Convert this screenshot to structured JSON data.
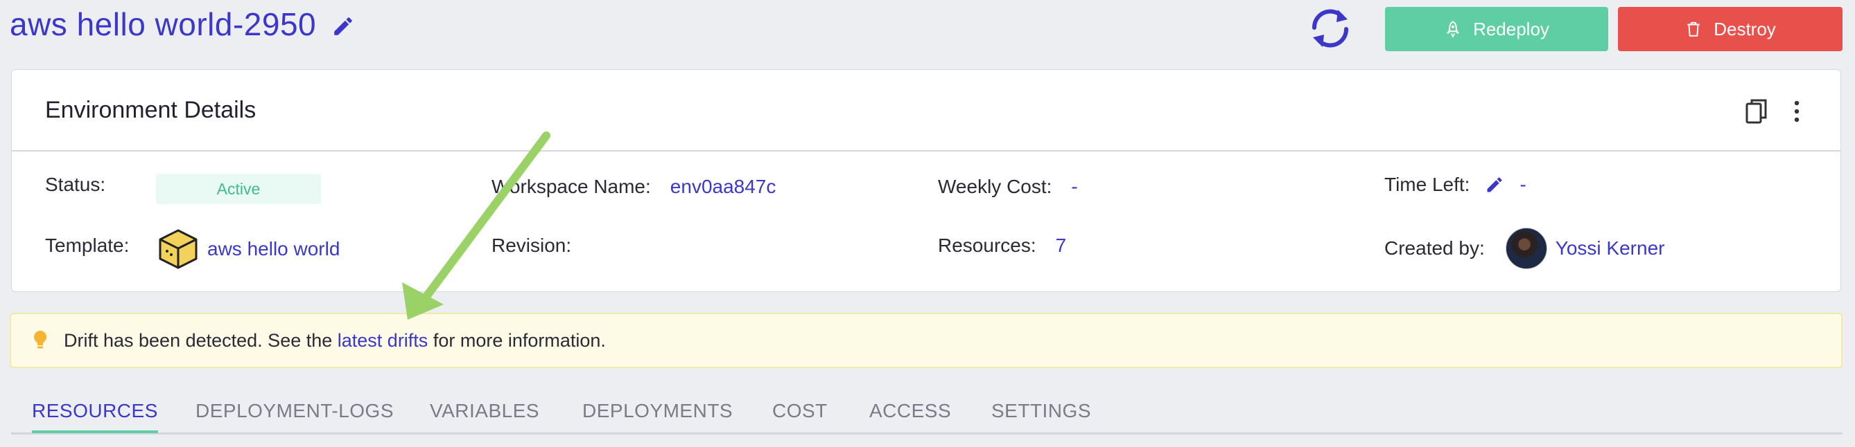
{
  "header": {
    "title": "aws hello world-2950",
    "redeploy_label": "Redeploy",
    "destroy_label": "Destroy",
    "accent_color": "#3b37c8",
    "redeploy_color": "#5fcea4",
    "destroy_color": "#e8504b"
  },
  "details": {
    "title": "Environment Details",
    "status_label": "Status:",
    "status_value": "Active",
    "workspace_label": "Workspace Name:",
    "workspace_value": "env0aa847c",
    "weekly_cost_label": "Weekly Cost:",
    "weekly_cost_value": "-",
    "time_left_label": "Time Left:",
    "time_left_value": "-",
    "template_label": "Template:",
    "template_value": "aws hello world",
    "revision_label": "Revision:",
    "resources_label": "Resources:",
    "resources_value": "7",
    "created_by_label": "Created by:",
    "created_by_value": "Yossi Kerner"
  },
  "alert": {
    "text_before": "Drift has been detected. See the ",
    "link_text": "latest drifts",
    "text_after": " for more information.",
    "bg_color": "#fdfae6"
  },
  "tabs": [
    {
      "label": "RESOURCES",
      "active": true
    },
    {
      "label": "DEPLOYMENT-LOGS",
      "active": false
    },
    {
      "label": "VARIABLES",
      "active": false
    },
    {
      "label": "DEPLOYMENTS",
      "active": false
    },
    {
      "label": "COST",
      "active": false
    },
    {
      "label": "ACCESS",
      "active": false
    },
    {
      "label": "SETTINGS",
      "active": false
    }
  ],
  "icons": {
    "edit": "pencil-icon",
    "refresh": "refresh-icon",
    "redeploy": "rocket-icon",
    "destroy": "trash-icon",
    "copy": "copy-icon",
    "more": "kebab-icon",
    "alert": "lightbulb-icon",
    "template": "cube-icon"
  }
}
